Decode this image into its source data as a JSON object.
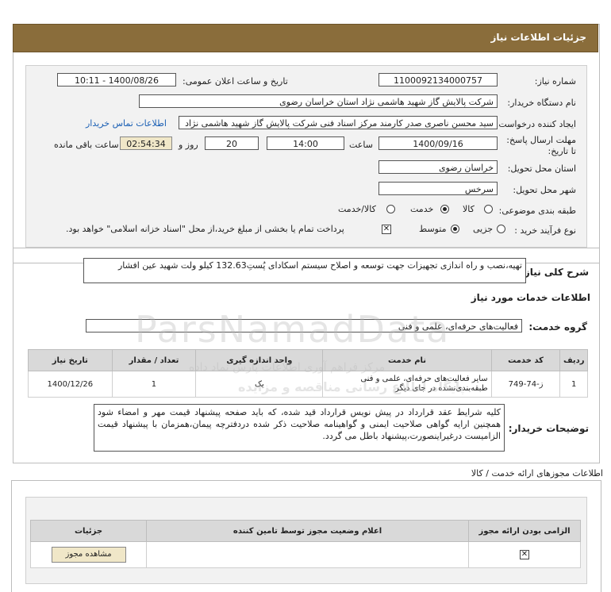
{
  "header": {
    "title": "جزئیات اطلاعات نیاز"
  },
  "form": {
    "need_number_label": "شماره نیاز:",
    "need_number": "1100092134000757",
    "announce_label": "تاریخ و ساعت اعلان عمومی:",
    "announce_value": "1400/08/26 - 10:11",
    "buyer_label": "نام دستگاه خریدار:",
    "buyer_value": "شرکت پالایش گاز شهید هاشمی نژاد   استان خراسان رضوی",
    "creator_label": "ایجاد کننده درخواست:",
    "creator_value": "سید محسن  ناصری صدر کارمند مرکز اسناد فنی شرکت پالایش گاز شهید هاشمی نژاد",
    "contact_link": "اطلاعات تماس خریدار",
    "deadline_label": "مهلت ارسال پاسخ: تا تاریخ:",
    "deadline_date": "1400/09/16",
    "time_label": "ساعت",
    "deadline_time": "14:00",
    "days_value": "20",
    "days_label": "روز و",
    "remaining_time": "02:54:34",
    "remaining_label": "ساعت باقی مانده",
    "province_label": "استان محل تحویل:",
    "province_value": "خراسان رضوی",
    "city_label": "شهر محل تحویل:",
    "city_value": "سرخس",
    "category_label": "طبقه بندی موضوعی:",
    "category_options": [
      "کالا",
      "خدمت",
      "کالا/خدمت"
    ],
    "category_selected": "خدمت",
    "process_label": "نوع فرآیند خرید :",
    "process_options": [
      "جزیی",
      "متوسط"
    ],
    "process_selected": "متوسط",
    "payment_note": "پرداخت تمام یا بخشی از مبلغ خرید،از محل \"اسناد خزانه اسلامی\" خواهد بود."
  },
  "summary": {
    "label": "شرح کلی نیاز:",
    "text": "تهیه،نصب و راه اندازی تجهیزات جهت توسعه و اصلاح سیستم اسکادای پُستِ132.63 کیلو ولت شهید عین افشار"
  },
  "services": {
    "section_title": "اطلاعات خدمات مورد نیاز",
    "group_label": "گروه خدمت:",
    "group_value": "فعالیت‌های حرفه‌ای، علمی و فنی",
    "columns": [
      "ردیف",
      "کد خدمت",
      "نام خدمت",
      "واحد اندازه گیری",
      "تعداد / مقدار",
      "تاریخ نیاز"
    ],
    "rows": [
      {
        "row": "1",
        "code": "ز-74-749",
        "name": "سایر فعالیت‌های حرفه‌ای، علمی و فنی طبقه‌بندی‌نشده در جای دیگر",
        "unit": "یک",
        "qty": "1",
        "date": "1400/12/26"
      }
    ]
  },
  "buyer_notes": {
    "label": "توضیحات خریدار:",
    "text": "کلیه شرایط عقد قرارداد در پیش نویس قرارداد قید شده، که باید صفحه پیشنهاد قیمت مهر و امضاء شود همچنین ارایه گواهی صلاحیت ایمنی و گواهینامه صلاحیت ذکر شده دردفترچه پیمان،همزمان با پیشنهاد قیمت الزامیست درغیراینصورت،پیشنهاد باطل می گردد."
  },
  "permits": {
    "section_title": "اطلاعات مجوزهای ارائه خدمت / کالا",
    "columns": [
      "الزامی بودن ارائه مجوز",
      "اعلام وضعیت مجوز توسط تامین کننده",
      "جزئیات"
    ],
    "view_button": "مشاهده مجوز"
  },
  "watermark": {
    "text": "ParsNamadData",
    "sub": "مرکز فراهم آوری اطلاعات پارس نماد داده",
    "sub2": "پایگاه اطلاع رسانی مناقصه و مزایده"
  }
}
